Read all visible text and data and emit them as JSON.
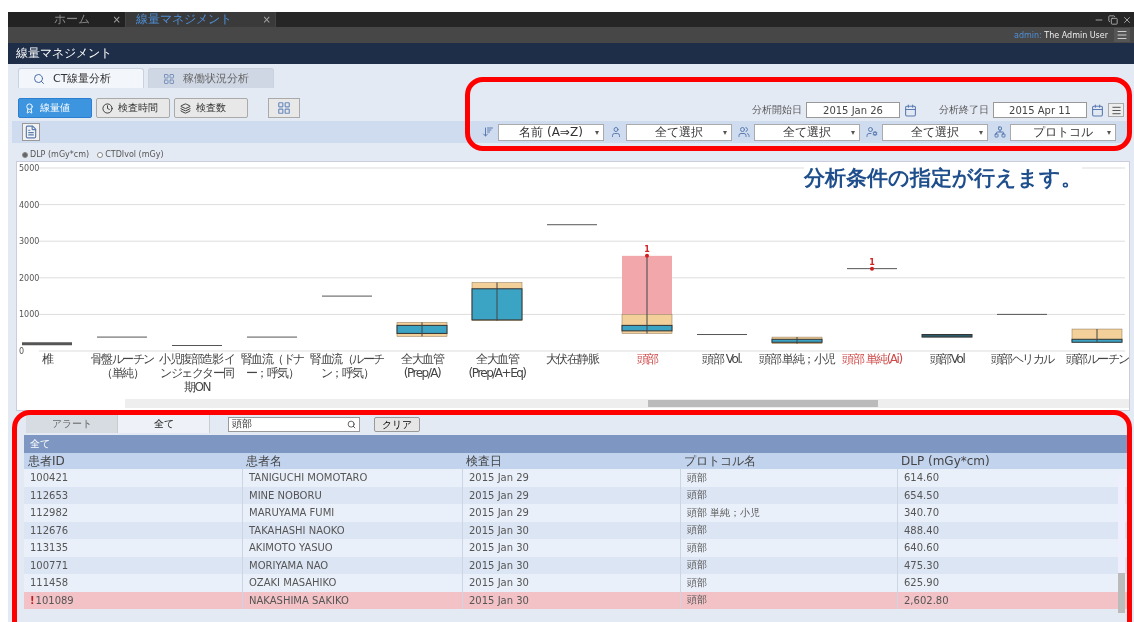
{
  "window_tabs": [
    {
      "label": "ホーム",
      "selected": false,
      "close": "×"
    },
    {
      "label": "線量マネジメント",
      "selected": true,
      "close": "×"
    }
  ],
  "user": {
    "role": "admin:",
    "name": "The Admin User"
  },
  "header": {
    "title": "線量マネジメント"
  },
  "view_tabs": [
    {
      "label": "CT線量分析",
      "selected": true
    },
    {
      "label": "稼働状況分析",
      "selected": false
    }
  ],
  "mode_buttons": [
    {
      "label": "線量値",
      "selected": true
    },
    {
      "label": "検査時間",
      "selected": false
    },
    {
      "label": "検査数",
      "selected": false
    }
  ],
  "date_range": [
    {
      "label": "分析開始日",
      "value": "2015 Jan 26"
    },
    {
      "label": "分析終了日",
      "value": "2015 Apr 11"
    }
  ],
  "filters": [
    {
      "value": "名前 (A⇒Z)"
    },
    {
      "value": "全て選択"
    },
    {
      "value": "全て選択"
    },
    {
      "value": "全て選択"
    },
    {
      "value": "プロトコル"
    }
  ],
  "metric_options": [
    {
      "label": "DLP (mGy*cm)",
      "selected": true
    },
    {
      "label": "CTDIvol (mGy)",
      "selected": false
    }
  ],
  "callout": "分析条件の指定が行えます。",
  "chart": {
    "yticks": [
      "5000",
      "4000",
      "3000",
      "2000",
      "1000",
      "0"
    ],
    "categories": [
      {
        "label": "椎",
        "alert": false
      },
      {
        "label": "骨盤ルーチン（単純）",
        "alert": false
      },
      {
        "label": "小児腹部造影 インジェクター同期ON",
        "alert": false
      },
      {
        "label": "腎血流（ドナー；呼気）",
        "alert": false
      },
      {
        "label": "腎血流（ルーチン；呼気）",
        "alert": false
      },
      {
        "label": "全大血管 (Prep/A)",
        "alert": false
      },
      {
        "label": "全大血管 (Prep/A+Eq)",
        "alert": false
      },
      {
        "label": "大伏在静脈",
        "alert": false
      },
      {
        "label": "頭部",
        "alert": true,
        "outlier": "1"
      },
      {
        "label": "頭部 Vol.",
        "alert": false
      },
      {
        "label": "頭部 単純；小児",
        "alert": false
      },
      {
        "label": "頭部 単純(Ai)",
        "alert": true,
        "outlier": "1"
      },
      {
        "label": "頭部Vol",
        "alert": false
      },
      {
        "label": "頭部ヘリカル",
        "alert": false
      },
      {
        "label": "頭部ルーチン",
        "alert": false
      }
    ]
  },
  "list_tabs": [
    {
      "label": "アラート",
      "selected": false
    },
    {
      "label": "全て",
      "selected": true
    }
  ],
  "search": {
    "value": "頭部"
  },
  "clear_button": "クリア",
  "group_header": "全て",
  "table": {
    "columns": [
      "患者ID",
      "患者名",
      "検査日",
      "プロトコル名",
      "DLP (mGy*cm)"
    ],
    "rows": [
      {
        "alert": false,
        "cells": [
          "100421",
          "TANIGUCHI MOMOTARO",
          "2015 Jan 29",
          "頭部",
          "614.60"
        ]
      },
      {
        "alert": false,
        "cells": [
          "112653",
          "MINE NOBORU",
          "2015 Jan 29",
          "頭部",
          "654.50"
        ]
      },
      {
        "alert": false,
        "cells": [
          "112982",
          "MARUYAMA FUMI",
          "2015 Jan 29",
          "頭部 単純；小児",
          "340.70"
        ]
      },
      {
        "alert": false,
        "cells": [
          "112676",
          "TAKAHASHI NAOKO",
          "2015 Jan 30",
          "頭部",
          "488.40"
        ]
      },
      {
        "alert": false,
        "cells": [
          "113135",
          "AKIMOTO YASUO",
          "2015 Jan 30",
          "頭部",
          "640.60"
        ]
      },
      {
        "alert": false,
        "cells": [
          "100771",
          "MORIYAMA NAO",
          "2015 Jan 30",
          "頭部",
          "475.30"
        ]
      },
      {
        "alert": false,
        "cells": [
          "111458",
          "OZAKI MASAHIKO",
          "2015 Jan 30",
          "頭部",
          "625.90"
        ]
      },
      {
        "alert": true,
        "mark": "!",
        "cells": [
          "101089",
          "NAKASHIMA SAKIKO",
          "2015 Jan 30",
          "頭部",
          "2,602.80"
        ]
      }
    ]
  }
}
